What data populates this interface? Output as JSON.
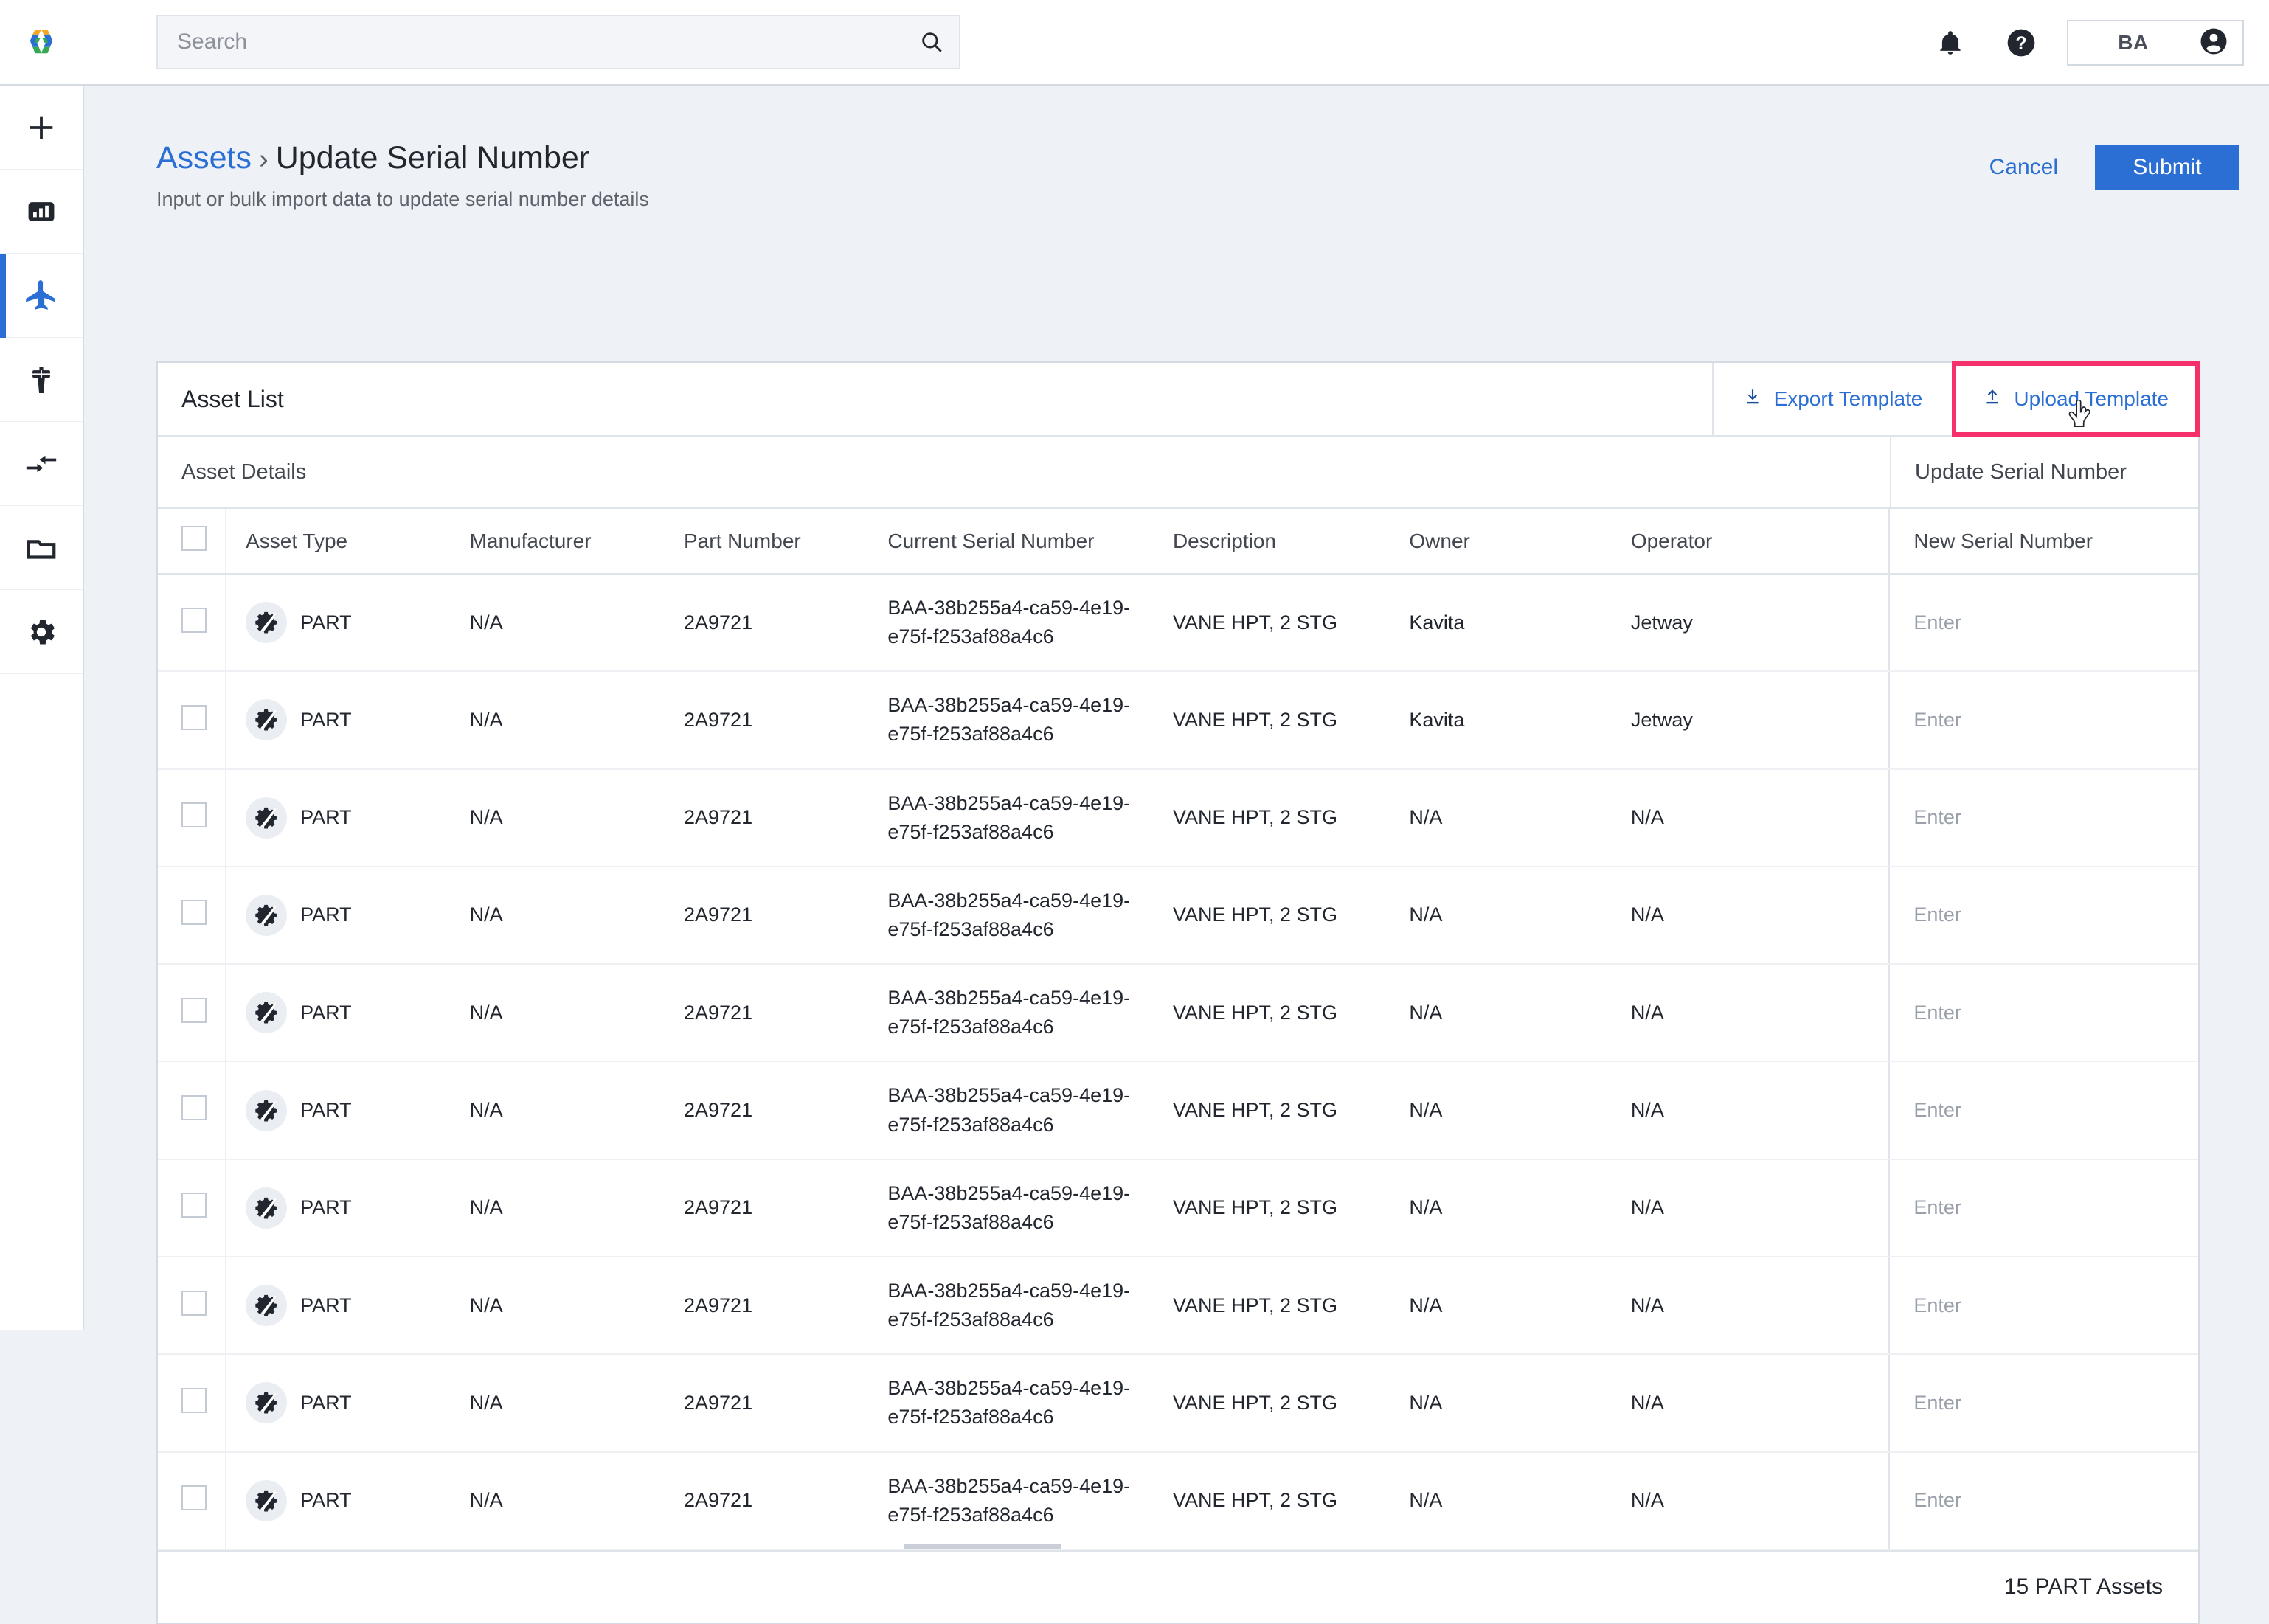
{
  "header": {
    "logo_icon": "hexagon-logo",
    "search": {
      "placeholder": "Search",
      "value": "",
      "icon": "search-icon"
    },
    "notifications_icon": "bell-icon",
    "help_icon": "help-circle-icon",
    "account": {
      "initials": "BA",
      "avatar_icon": "account-circle-icon"
    }
  },
  "sidebar": {
    "items": [
      {
        "icon": "plus-icon",
        "name": "add",
        "active": false
      },
      {
        "icon": "dashboard-chart-icon",
        "name": "dashboard",
        "active": false
      },
      {
        "icon": "airplane-icon",
        "name": "assets",
        "active": true
      },
      {
        "icon": "control-tower-icon",
        "name": "operations",
        "active": false
      },
      {
        "icon": "transfer-arrows-icon",
        "name": "transfers",
        "active": false
      },
      {
        "icon": "folder-icon",
        "name": "documents",
        "active": false
      },
      {
        "icon": "gear-icon",
        "name": "settings",
        "active": false
      }
    ],
    "active_color": "#2b6fd4"
  },
  "page": {
    "breadcrumb_link": "Assets",
    "breadcrumb_separator": "›",
    "title": "Update Serial Number",
    "subtitle": "Input or bulk import data to update serial number details",
    "cancel_label": "Cancel",
    "submit_label": "Submit",
    "accent_color": "#2b6fd4"
  },
  "card": {
    "title": "Asset List",
    "export_label": "Export Template",
    "export_icon": "download-icon",
    "upload_label": "Upload Template",
    "upload_icon": "upload-icon",
    "upload_highlight_color": "#f5306b",
    "cursor_icon": "pointer-hand-cursor",
    "group_left_label": "Asset Details",
    "group_right_label": "Update Serial Number",
    "footer_count": "15 PART Assets"
  },
  "table": {
    "columns": [
      "Asset Type",
      "Manufacturer",
      "Part Number",
      "Current Serial Number",
      "Description",
      "Owner",
      "Operator",
      "New Serial Number"
    ],
    "new_serial_placeholder": "Enter",
    "row_icon": "part-gear-icon",
    "rows": [
      {
        "checked": false,
        "asset_type": "PART",
        "manufacturer": "N/A",
        "part_number": "2A9721",
        "current_serial": "BAA-38b255a4-ca59-4e19-e75f-f253af88a4c6",
        "description": "VANE HPT, 2 STG",
        "owner": "Kavita",
        "operator": "Jetway",
        "new_serial": ""
      },
      {
        "checked": false,
        "asset_type": "PART",
        "manufacturer": "N/A",
        "part_number": "2A9721",
        "current_serial": "BAA-38b255a4-ca59-4e19-e75f-f253af88a4c6",
        "description": "VANE HPT, 2 STG",
        "owner": "Kavita",
        "operator": "Jetway",
        "new_serial": ""
      },
      {
        "checked": false,
        "asset_type": "PART",
        "manufacturer": "N/A",
        "part_number": "2A9721",
        "current_serial": "BAA-38b255a4-ca59-4e19-e75f-f253af88a4c6",
        "description": "VANE HPT, 2 STG",
        "owner": "N/A",
        "operator": "N/A",
        "new_serial": ""
      },
      {
        "checked": false,
        "asset_type": "PART",
        "manufacturer": "N/A",
        "part_number": "2A9721",
        "current_serial": "BAA-38b255a4-ca59-4e19-e75f-f253af88a4c6",
        "description": "VANE HPT, 2 STG",
        "owner": "N/A",
        "operator": "N/A",
        "new_serial": ""
      },
      {
        "checked": false,
        "asset_type": "PART",
        "manufacturer": "N/A",
        "part_number": "2A9721",
        "current_serial": "BAA-38b255a4-ca59-4e19-e75f-f253af88a4c6",
        "description": "VANE HPT, 2 STG",
        "owner": "N/A",
        "operator": "N/A",
        "new_serial": ""
      },
      {
        "checked": false,
        "asset_type": "PART",
        "manufacturer": "N/A",
        "part_number": "2A9721",
        "current_serial": "BAA-38b255a4-ca59-4e19-e75f-f253af88a4c6",
        "description": "VANE HPT, 2 STG",
        "owner": "N/A",
        "operator": "N/A",
        "new_serial": ""
      },
      {
        "checked": false,
        "asset_type": "PART",
        "manufacturer": "N/A",
        "part_number": "2A9721",
        "current_serial": "BAA-38b255a4-ca59-4e19-e75f-f253af88a4c6",
        "description": "VANE HPT, 2 STG",
        "owner": "N/A",
        "operator": "N/A",
        "new_serial": ""
      },
      {
        "checked": false,
        "asset_type": "PART",
        "manufacturer": "N/A",
        "part_number": "2A9721",
        "current_serial": "BAA-38b255a4-ca59-4e19-e75f-f253af88a4c6",
        "description": "VANE HPT, 2 STG",
        "owner": "N/A",
        "operator": "N/A",
        "new_serial": ""
      },
      {
        "checked": false,
        "asset_type": "PART",
        "manufacturer": "N/A",
        "part_number": "2A9721",
        "current_serial": "BAA-38b255a4-ca59-4e19-e75f-f253af88a4c6",
        "description": "VANE HPT, 2 STG",
        "owner": "N/A",
        "operator": "N/A",
        "new_serial": ""
      },
      {
        "checked": false,
        "asset_type": "PART",
        "manufacturer": "N/A",
        "part_number": "2A9721",
        "current_serial": "BAA-38b255a4-ca59-4e19-e75f-f253af88a4c6",
        "description": "VANE HPT, 2 STG",
        "owner": "N/A",
        "operator": "N/A",
        "new_serial": ""
      }
    ]
  }
}
